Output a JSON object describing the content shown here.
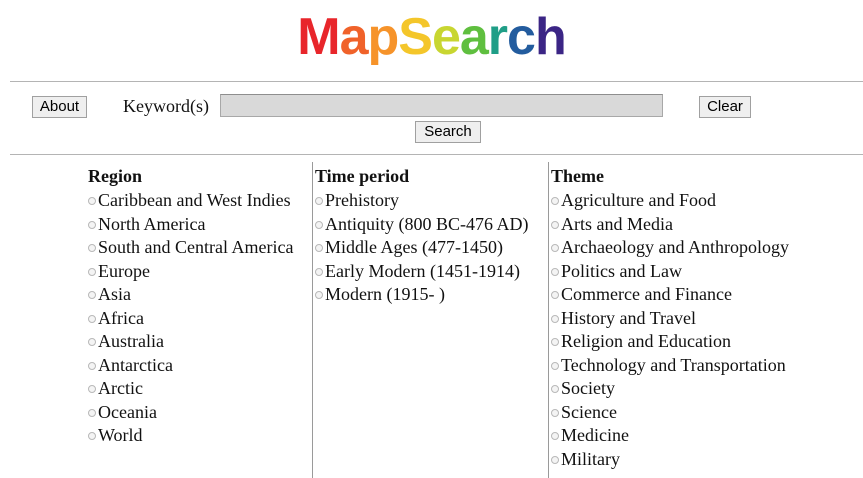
{
  "logo": {
    "letters": [
      {
        "ch": "M",
        "color": "#e8262b"
      },
      {
        "ch": "a",
        "color": "#f0622a"
      },
      {
        "ch": "p",
        "color": "#f6932a"
      },
      {
        "ch": "S",
        "color": "#f4c62a"
      },
      {
        "ch": "e",
        "color": "#c8d631"
      },
      {
        "ch": "a",
        "color": "#5fbf3f"
      },
      {
        "ch": "r",
        "color": "#1f9e87"
      },
      {
        "ch": "c",
        "color": "#235c9e"
      },
      {
        "ch": "h",
        "color": "#3b2585"
      }
    ]
  },
  "toolbar": {
    "about_label": "About",
    "keyword_label": "Keyword(s)",
    "keyword_value": "",
    "clear_label": "Clear",
    "search_label": "Search"
  },
  "columns": {
    "region": {
      "title": "Region",
      "items": [
        "Caribbean and West Indies",
        "North America",
        "South and Central America",
        "Europe",
        "Asia",
        "Africa",
        "Australia",
        "Antarctica",
        "Arctic",
        "Oceania",
        "World"
      ]
    },
    "time": {
      "title": "Time period",
      "items": [
        "Prehistory",
        "Antiquity (800 BC-476 AD)",
        "Middle Ages (477-1450)",
        "Early Modern (1451-1914)",
        "Modern (1915- )"
      ]
    },
    "theme": {
      "title": "Theme",
      "items": [
        "Agriculture and Food",
        "Arts and Media",
        "Archaeology and Anthropology",
        "Politics and Law",
        "Commerce and Finance",
        "History and Travel",
        "Religion and Education",
        "Technology and Transportation",
        "Society",
        "Science",
        "Medicine",
        "Military"
      ]
    }
  }
}
